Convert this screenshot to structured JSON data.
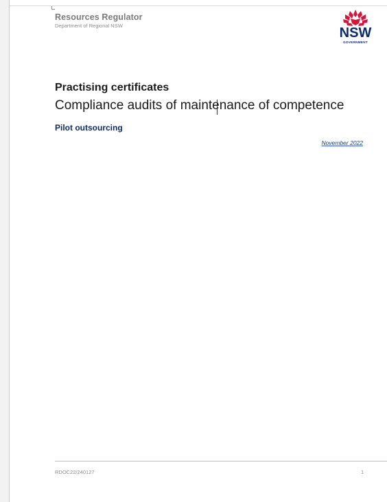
{
  "header": {
    "organization": "Resources Regulator",
    "department": "Department of Regional NSW",
    "logo": {
      "icon": "waratah-icon",
      "word": "NSW",
      "sub": "GOVERNMENT",
      "flower_color": "#d7153a",
      "text_color": "#0a2a6b"
    }
  },
  "document": {
    "title": "Practising certificates",
    "subtitle": "Compliance audits of maintenance of competence",
    "tag": "Pilot outsourcing",
    "date": "November 2022"
  },
  "footer": {
    "reference": "RDOC22/240127",
    "page_number": "1"
  },
  "colors": {
    "heading_navy": "#0e2a63",
    "muted_gray": "#7a7a7a"
  }
}
